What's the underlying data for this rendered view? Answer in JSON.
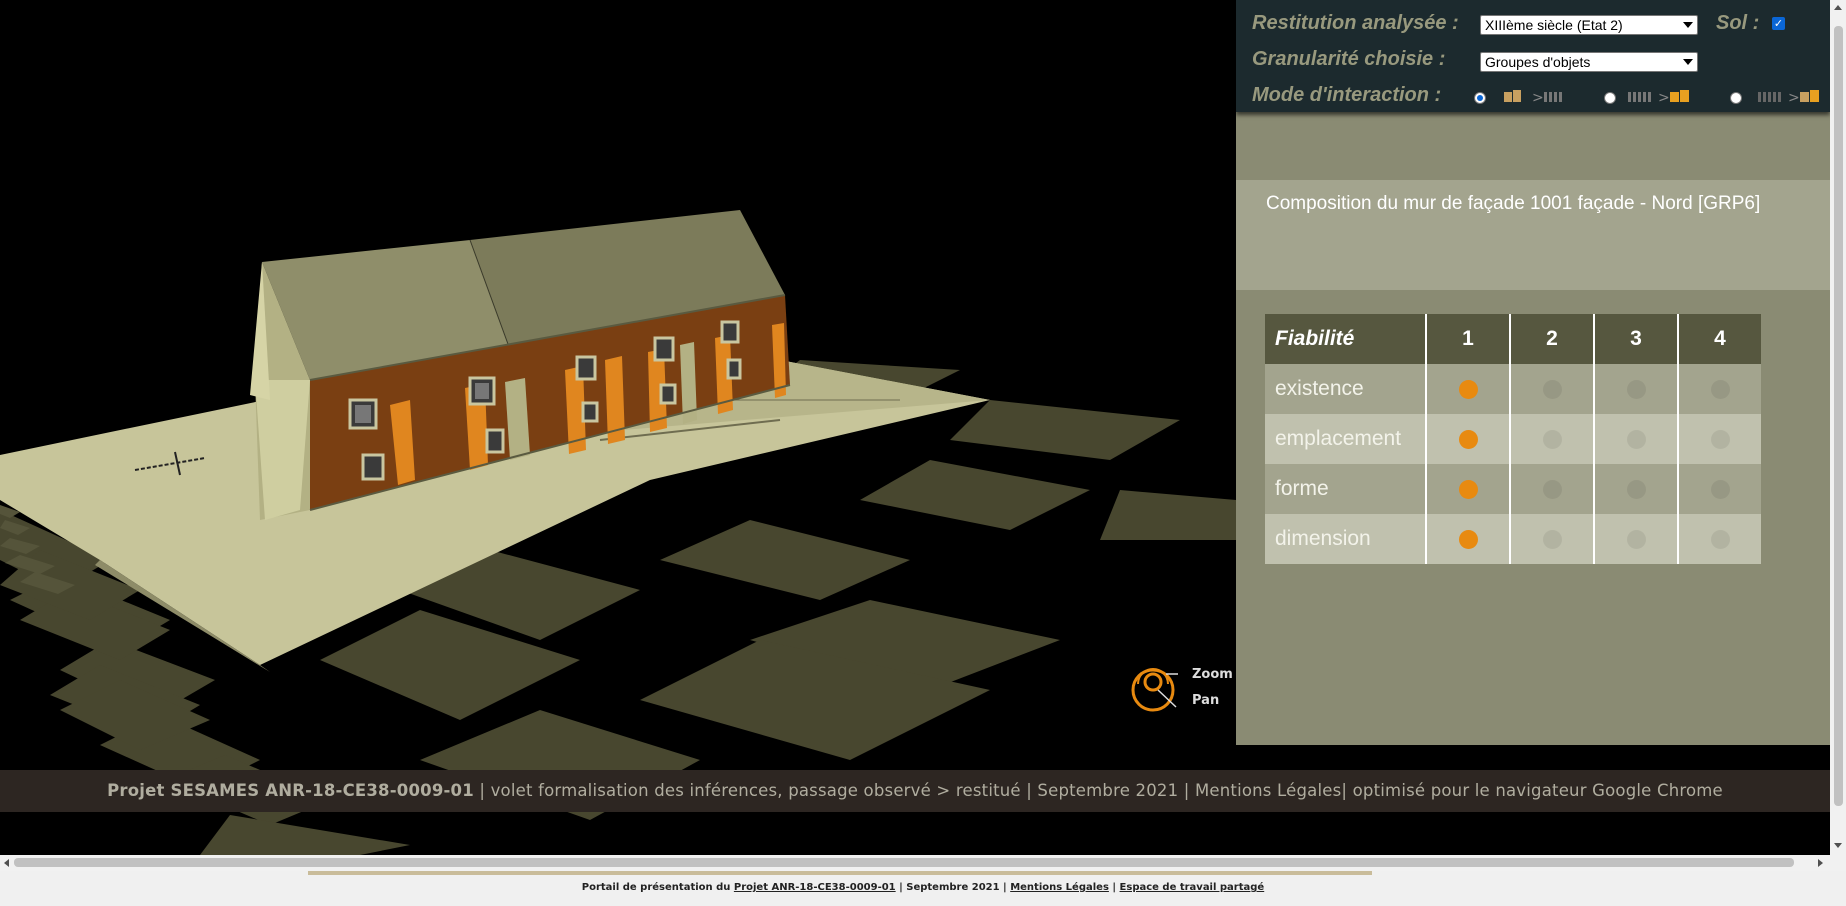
{
  "controls": {
    "restitution_label": "Restitution analysée :",
    "restitution_value": "XIIIème siècle (Etat 2)",
    "sol_label": "Sol :",
    "sol_checked": true,
    "granularite_label": "Granularité choisie :",
    "granularite_value": "Groupes d'objets",
    "mode_label": "Mode d'interaction :",
    "mode_selected": 1
  },
  "info": {
    "title": "Composition du mur de façade 1001 façade - Nord [GRP6]"
  },
  "reliability_table": {
    "header_label": "Fiabilité",
    "columns": [
      "1",
      "2",
      "3",
      "4"
    ],
    "rows": [
      {
        "label": "existence",
        "level": 1
      },
      {
        "label": "emplacement",
        "level": 1
      },
      {
        "label": "forme",
        "level": 1
      },
      {
        "label": "dimension",
        "level": 1
      }
    ]
  },
  "zoom_pan": {
    "zoom_label": "Zoom",
    "pan_label": "Pan"
  },
  "footer": {
    "project": "Projet SESAMES ANR-18-CE38-0009-01",
    "text": " | volet formalisation des inférences, passage observé > restitué | Septembre 2021 | Mentions Légales| optimisé pour le navigateur Google Chrome"
  },
  "bottom_bar": {
    "prefix": "Portail de présentation du ",
    "project_link": "Projet ANR-18-CE38-0009-01",
    "middle": " | Septembre 2021 | ",
    "legal_link": "Mentions Légales",
    "sep": " | ",
    "workspace_link": "Espace de travail partagé"
  },
  "colors": {
    "accent_orange": "#e88a10",
    "panel": "#8a8b73",
    "controls_bg": "#1c2a2e",
    "footer_bg": "#2d2622"
  }
}
